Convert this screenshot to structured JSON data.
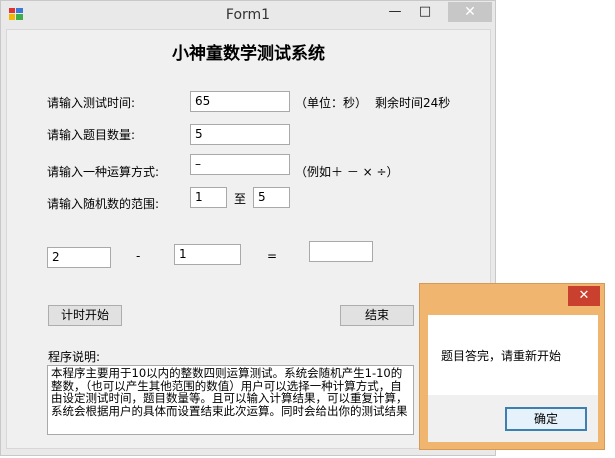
{
  "window": {
    "title": "Form1",
    "app_icon": "winforms-app-icon",
    "min_glyph": "—",
    "max_glyph": "□",
    "close_glyph": "✕"
  },
  "form": {
    "heading": "小神童数学测试系统",
    "time_label": "请输入测试时间:",
    "time_value": "65",
    "time_unit": "（单位：秒）",
    "remaining": "剩余时间24秒",
    "count_label": "请输入题目数量:",
    "count_value": "5",
    "op_label": "请输入一种运算方式:",
    "op_value": "–",
    "op_example": "（例如＋ － × ÷）",
    "range_label": "请输入随机数的范围:",
    "range_from": "1",
    "range_to_label": "至",
    "range_to": "5",
    "operand1": "2",
    "operator": "-",
    "operand2": "1",
    "equals": "=",
    "answer": "",
    "start_button": "计时开始",
    "end_button": "结束",
    "desc_label": "程序说明:",
    "description": "本程序主要用于10以内的整数四则运算测试。系统会随机产生1-10的整数，（也可以产生其他范围的数值）用户可以选择一种计算方式，自由设定测试时间，题目数量等。且可以输入计算结果，可以重复计算，系统会根据用户的具体而设置结束此次运算。同时会给出你的测试结果"
  },
  "dialog": {
    "close_glyph": "✕",
    "message": "题目答完，请重新开始",
    "ok_button": "确定"
  }
}
